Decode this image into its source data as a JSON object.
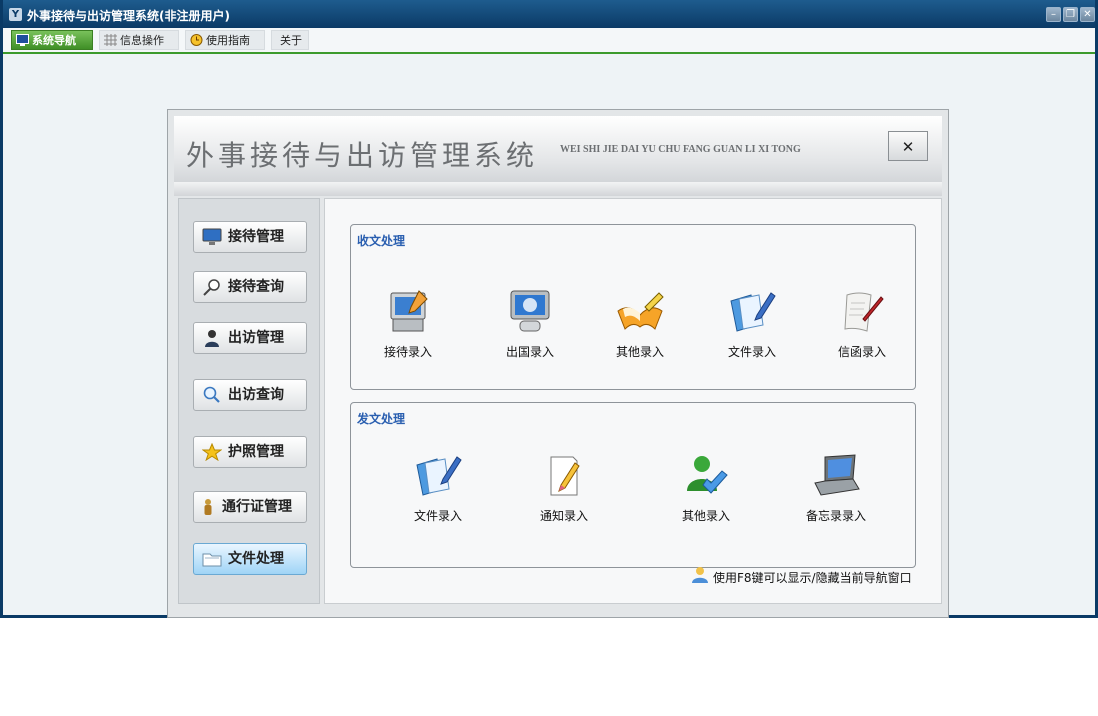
{
  "window": {
    "title": "外事接待与出访管理系统(非注册用户)",
    "app_icon": "Y",
    "controls": [
      "–",
      "❐",
      "✕"
    ]
  },
  "menu_tabs": [
    {
      "label": "系统导航",
      "icon": "monitor-icon",
      "active": true
    },
    {
      "label": "信息操作",
      "icon": "grid-icon",
      "active": false
    },
    {
      "label": "使用指南",
      "icon": "clock-icon",
      "active": false
    },
    {
      "label": "关于",
      "icon": "",
      "active": false
    }
  ],
  "dialog": {
    "title": "外事接待与出访管理系统",
    "pinyin": "WEI SHI JIE DAI YU CHU FANG GUAN  LI  XI  TONG",
    "close_label": "✕"
  },
  "sidebar": {
    "items": [
      {
        "label": "接待管理",
        "icon": "monitor-icon",
        "active": false
      },
      {
        "label": "接待查询",
        "icon": "magnifier-icon",
        "active": false
      },
      {
        "label": "出访管理",
        "icon": "user-icon",
        "active": false
      },
      {
        "label": "出访查询",
        "icon": "search-icon",
        "active": false
      },
      {
        "label": "护照管理",
        "icon": "star-icon",
        "active": false
      },
      {
        "label": "通行证管理",
        "icon": "person-badge-icon",
        "active": false
      },
      {
        "label": "文件处理",
        "icon": "folder-icon",
        "active": true
      }
    ]
  },
  "incoming": {
    "title": "收文处理",
    "items": [
      {
        "label": "接待录入",
        "icon": "computer-edit-icon"
      },
      {
        "label": "出国录入",
        "icon": "monitor-globe-icon"
      },
      {
        "label": "其他录入",
        "icon": "open-book-icon"
      },
      {
        "label": "文件录入",
        "icon": "document-pen-icon"
      },
      {
        "label": "信函录入",
        "icon": "scroll-icon"
      }
    ]
  },
  "outgoing": {
    "title": "发文处理",
    "items": [
      {
        "label": "文件录入",
        "icon": "document-pen-icon"
      },
      {
        "label": "通知录入",
        "icon": "note-pencil-icon"
      },
      {
        "label": "其他录入",
        "icon": "user-check-icon"
      },
      {
        "label": "备忘录录入",
        "icon": "laptop-icon"
      }
    ]
  },
  "hint": {
    "text": "使用F8键可以显示/隐藏当前导航窗口",
    "icon": "user-info-icon"
  }
}
